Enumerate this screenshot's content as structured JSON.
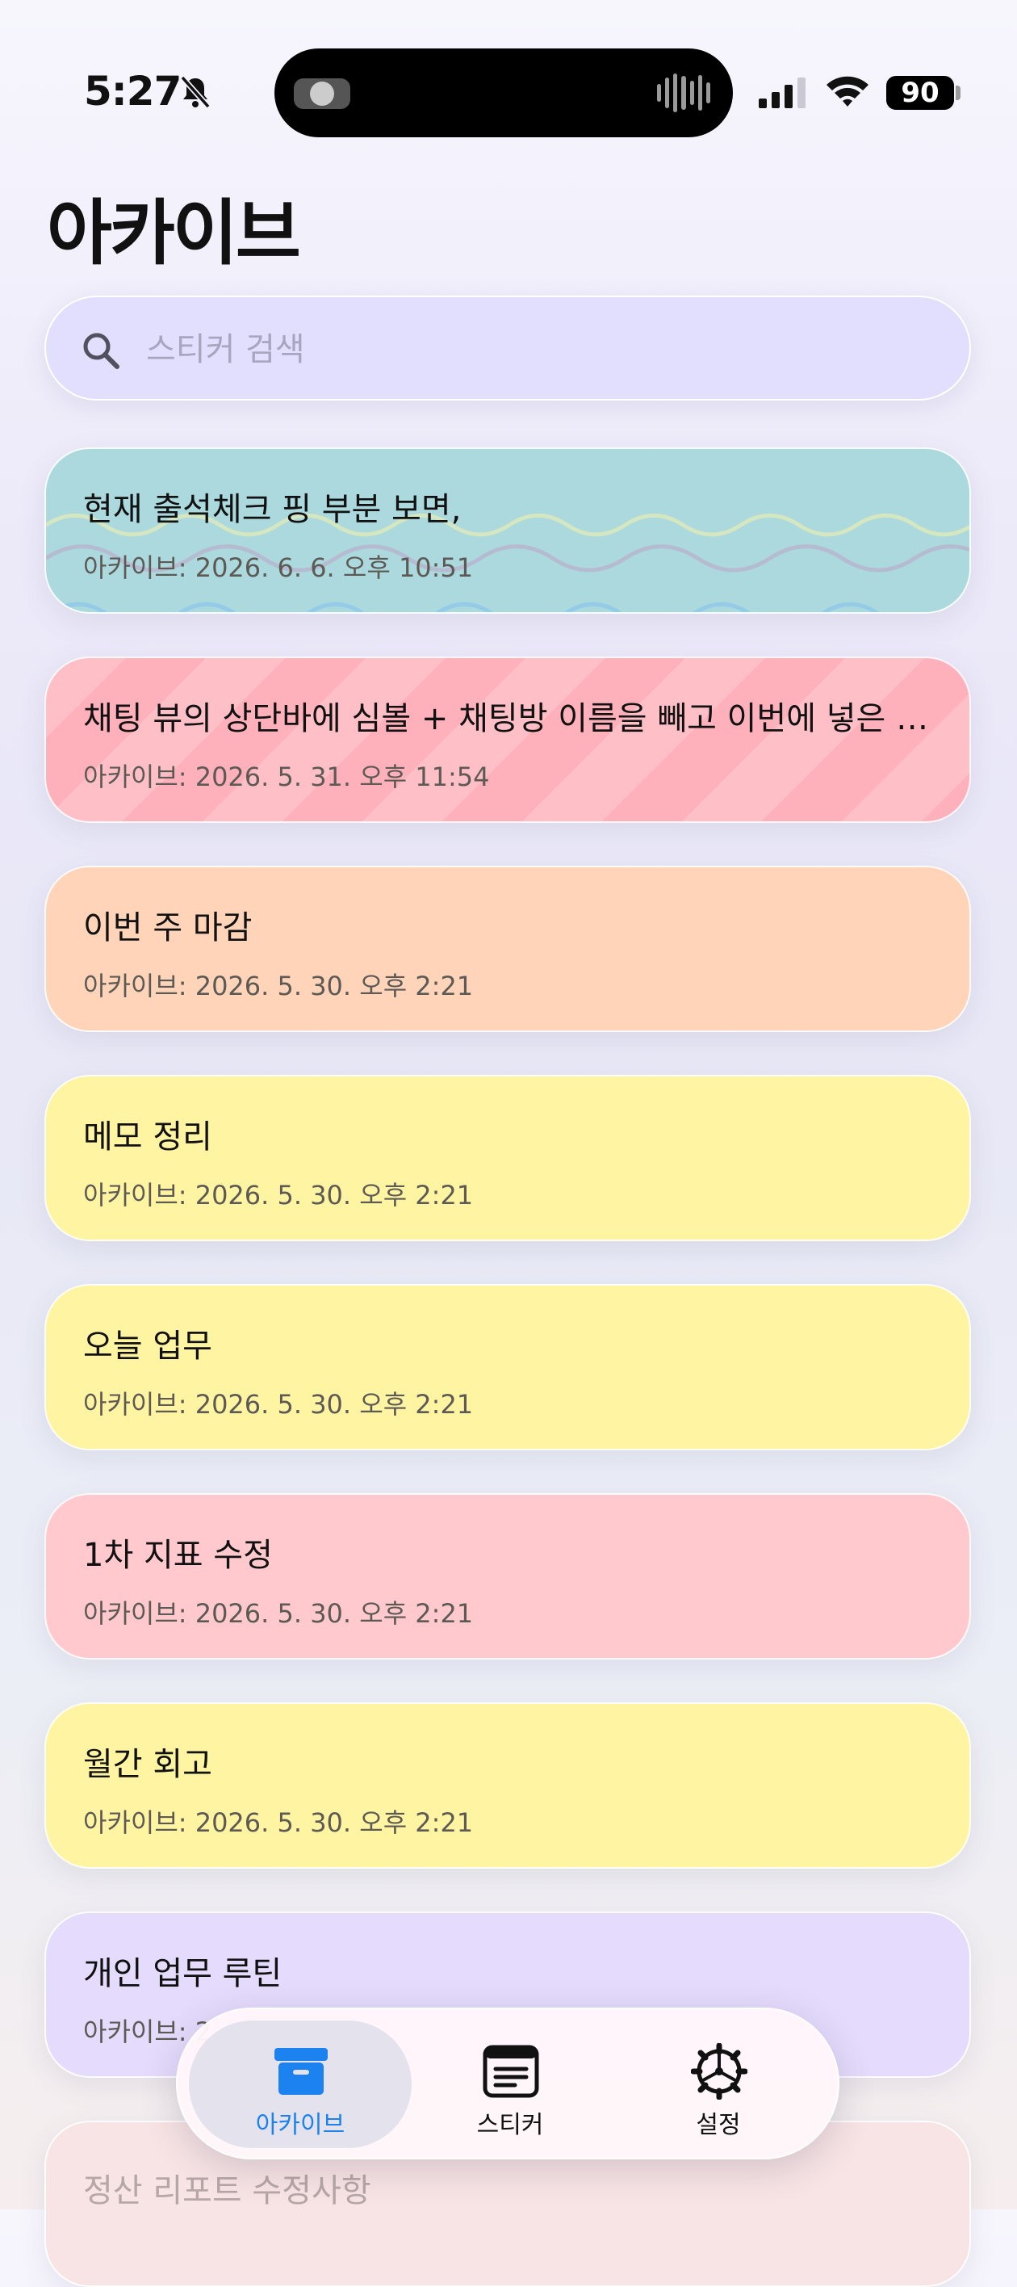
{
  "status_bar": {
    "time": "5:27",
    "battery": "90"
  },
  "page": {
    "title": "아카이브"
  },
  "search": {
    "placeholder": "스티커 검색"
  },
  "stickers": [
    {
      "title": "현재 출석체크 핑 부분 보면,",
      "date": "아카이브: 2026. 6. 6. 오후 10:51",
      "color": "#acd9dd"
    },
    {
      "title": "채팅 뷰의 상단바에 심볼 + 채팅방 이름을 빼고 이번에 넣은 이...",
      "date": "아카이브: 2026. 5. 31. 오후 11:54",
      "color": "#ffb1bb"
    },
    {
      "title": "이번 주 마감",
      "date": "아카이브: 2026. 5. 30. 오후 2:21",
      "color": "#ffd4b8"
    },
    {
      "title": "메모 정리",
      "date": "아카이브: 2026. 5. 30. 오후 2:21",
      "color": "#fff4a2"
    },
    {
      "title": "오늘 업무",
      "date": "아카이브: 2026. 5. 30. 오후 2:21",
      "color": "#fff4a2"
    },
    {
      "title": "1차 지표 수정",
      "date": "아카이브: 2026. 5. 30. 오후 2:21",
      "color": "#ffc9cd"
    },
    {
      "title": "월간 회고",
      "date": "아카이브: 2026. 5. 30. 오후 2:21",
      "color": "#fff4a2"
    },
    {
      "title": "개인 업무 루틴",
      "date": "아카이브: 2",
      "color": "#e5dbfc"
    },
    {
      "title": "정산 리포트 수정사항",
      "date": "",
      "color": "#f8e4e4"
    }
  ],
  "tab_bar": {
    "archive": "아카이브",
    "sticker": "스티커",
    "settings": "설정",
    "active_color": "#1b82f0"
  }
}
